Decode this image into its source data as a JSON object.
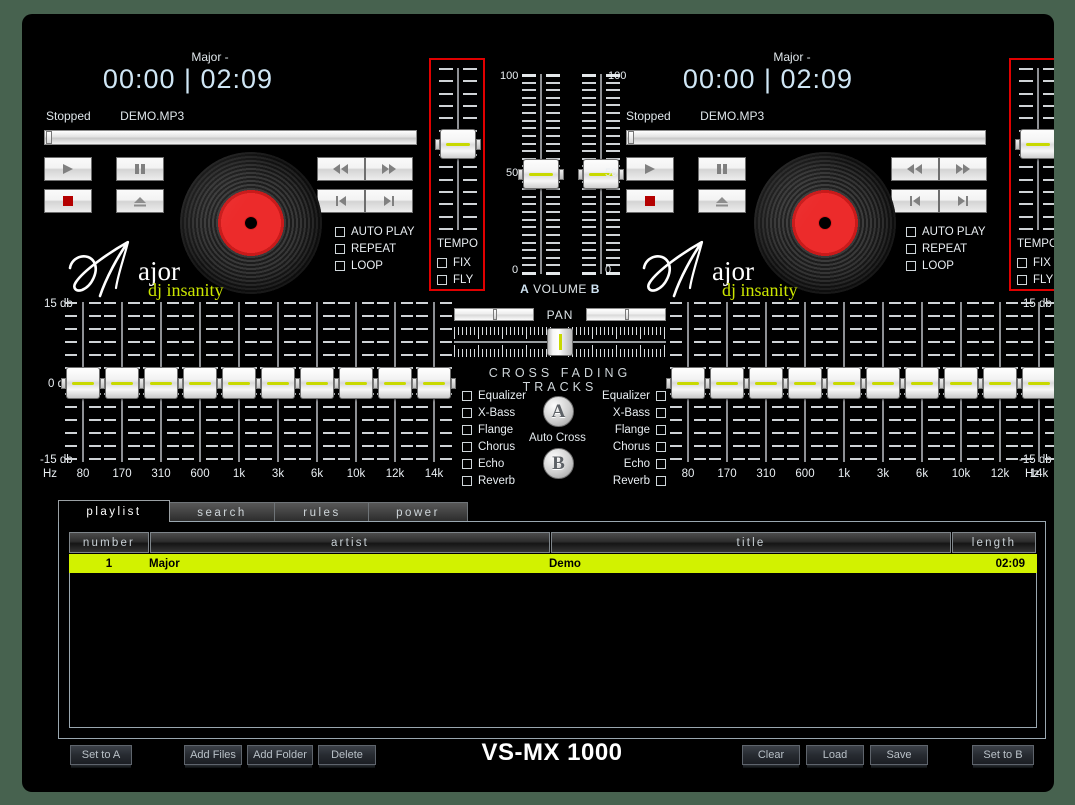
{
  "app": {
    "brand": "VS-MX 1000",
    "bg_outer": "#47624f",
    "accent_green": "#d2f200",
    "accent_red": "#e00000"
  },
  "decks": [
    {
      "id": "A",
      "track_title": "Major -",
      "time": "00:00 | 02:09",
      "status": "Stopped",
      "filename": "DEMO.MP3",
      "logo_name": "ajor",
      "logo_tagline": "dj insanity",
      "transport": [
        {
          "name": "play-button",
          "glyph": "play"
        },
        {
          "name": "pause-button",
          "glyph": "pause"
        },
        {
          "name": "stop-button",
          "glyph": "stop"
        },
        {
          "name": "eject-button",
          "glyph": "eject"
        },
        {
          "name": "rewind-button",
          "glyph": "rewind"
        },
        {
          "name": "fastforward-button",
          "glyph": "fastforward"
        },
        {
          "name": "prev-track-button",
          "glyph": "prev"
        },
        {
          "name": "next-track-button",
          "glyph": "next"
        }
      ],
      "options": [
        "AUTO PLAY",
        "REPEAT",
        "LOOP"
      ],
      "tempo": {
        "label": "TEMPO",
        "fix": "FIX",
        "fly": "FLY"
      }
    },
    {
      "id": "B",
      "track_title": "Major -",
      "time": "00:00 | 02:09",
      "status": "Stopped",
      "filename": "DEMO.MP3",
      "logo_name": "ajor",
      "logo_tagline": "dj insanity",
      "options": [
        "AUTO PLAY",
        "REPEAT",
        "LOOP"
      ],
      "tempo": {
        "label": "TEMPO",
        "fix": "FIX",
        "fly": "FLY"
      }
    }
  ],
  "volume": {
    "caption_a": "A",
    "caption_label": "VOLUME",
    "caption_b": "B",
    "scale_top": "100",
    "scale_mid": "50",
    "scale_bottom": "0",
    "value_a": 50,
    "value_b": 50
  },
  "pan": {
    "label": "PAN",
    "value_a": 50,
    "value_b": 50
  },
  "crossfade": {
    "caption": "CROSS FADING TRACKS",
    "value": 50
  },
  "effects": {
    "left": [
      "Equalizer",
      "X-Bass",
      "Flange",
      "Chorus",
      "Echo",
      "Reverb"
    ],
    "right": [
      "Equalizer",
      "X-Bass",
      "Flange",
      "Chorus",
      "Echo",
      "Reverb"
    ],
    "auto_cross_label": "Auto Cross",
    "deck_a_badge": "A",
    "deck_b_badge": "B"
  },
  "equalizer": {
    "db_top": "15 db",
    "db_mid": "0 db",
    "db_bottom": "-15 db",
    "hz_label": "Hz",
    "bands": [
      "80",
      "170",
      "310",
      "600",
      "1k",
      "3k",
      "6k",
      "10k",
      "12k",
      "14k"
    ],
    "values": [
      0,
      0,
      0,
      0,
      0,
      0,
      0,
      0,
      0,
      0
    ]
  },
  "tabs": [
    {
      "label": "playlist",
      "active": true
    },
    {
      "label": "search",
      "active": false
    },
    {
      "label": "rules",
      "active": false
    },
    {
      "label": "power",
      "active": false
    }
  ],
  "playlist": {
    "columns": [
      "number",
      "artist",
      "title",
      "length"
    ],
    "rows": [
      {
        "number": "1",
        "artist": "Major",
        "title": "Demo",
        "length": "02:09"
      }
    ]
  },
  "bottom_buttons": {
    "left": [
      "Set to A"
    ],
    "mid_left": [
      "Add Files",
      "Add Folder",
      "Delete"
    ],
    "mid_right": [
      "Clear",
      "Load",
      "Save"
    ],
    "right": [
      "Set to B"
    ]
  }
}
